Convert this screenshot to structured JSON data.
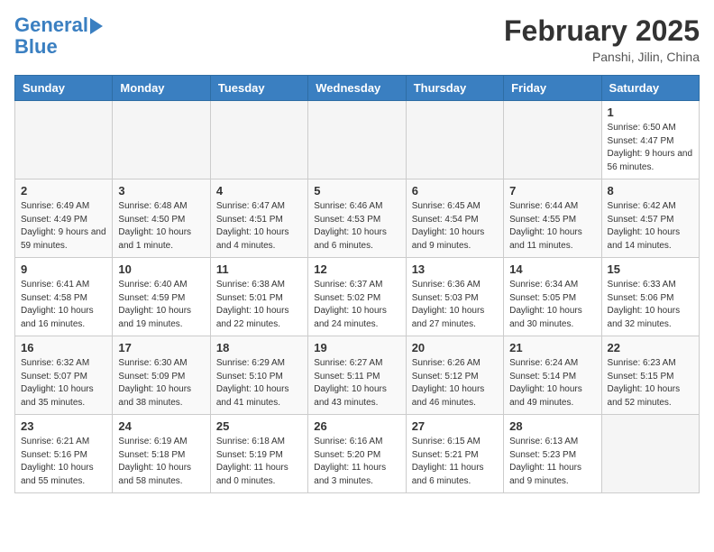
{
  "header": {
    "logo_line1": "General",
    "logo_line2": "Blue",
    "month_title": "February 2025",
    "location": "Panshi, Jilin, China"
  },
  "days_of_week": [
    "Sunday",
    "Monday",
    "Tuesday",
    "Wednesday",
    "Thursday",
    "Friday",
    "Saturday"
  ],
  "weeks": [
    [
      {
        "day": "",
        "info": ""
      },
      {
        "day": "",
        "info": ""
      },
      {
        "day": "",
        "info": ""
      },
      {
        "day": "",
        "info": ""
      },
      {
        "day": "",
        "info": ""
      },
      {
        "day": "",
        "info": ""
      },
      {
        "day": "1",
        "info": "Sunrise: 6:50 AM\nSunset: 4:47 PM\nDaylight: 9 hours and 56 minutes."
      }
    ],
    [
      {
        "day": "2",
        "info": "Sunrise: 6:49 AM\nSunset: 4:49 PM\nDaylight: 9 hours and 59 minutes."
      },
      {
        "day": "3",
        "info": "Sunrise: 6:48 AM\nSunset: 4:50 PM\nDaylight: 10 hours and 1 minute."
      },
      {
        "day": "4",
        "info": "Sunrise: 6:47 AM\nSunset: 4:51 PM\nDaylight: 10 hours and 4 minutes."
      },
      {
        "day": "5",
        "info": "Sunrise: 6:46 AM\nSunset: 4:53 PM\nDaylight: 10 hours and 6 minutes."
      },
      {
        "day": "6",
        "info": "Sunrise: 6:45 AM\nSunset: 4:54 PM\nDaylight: 10 hours and 9 minutes."
      },
      {
        "day": "7",
        "info": "Sunrise: 6:44 AM\nSunset: 4:55 PM\nDaylight: 10 hours and 11 minutes."
      },
      {
        "day": "8",
        "info": "Sunrise: 6:42 AM\nSunset: 4:57 PM\nDaylight: 10 hours and 14 minutes."
      }
    ],
    [
      {
        "day": "9",
        "info": "Sunrise: 6:41 AM\nSunset: 4:58 PM\nDaylight: 10 hours and 16 minutes."
      },
      {
        "day": "10",
        "info": "Sunrise: 6:40 AM\nSunset: 4:59 PM\nDaylight: 10 hours and 19 minutes."
      },
      {
        "day": "11",
        "info": "Sunrise: 6:38 AM\nSunset: 5:01 PM\nDaylight: 10 hours and 22 minutes."
      },
      {
        "day": "12",
        "info": "Sunrise: 6:37 AM\nSunset: 5:02 PM\nDaylight: 10 hours and 24 minutes."
      },
      {
        "day": "13",
        "info": "Sunrise: 6:36 AM\nSunset: 5:03 PM\nDaylight: 10 hours and 27 minutes."
      },
      {
        "day": "14",
        "info": "Sunrise: 6:34 AM\nSunset: 5:05 PM\nDaylight: 10 hours and 30 minutes."
      },
      {
        "day": "15",
        "info": "Sunrise: 6:33 AM\nSunset: 5:06 PM\nDaylight: 10 hours and 32 minutes."
      }
    ],
    [
      {
        "day": "16",
        "info": "Sunrise: 6:32 AM\nSunset: 5:07 PM\nDaylight: 10 hours and 35 minutes."
      },
      {
        "day": "17",
        "info": "Sunrise: 6:30 AM\nSunset: 5:09 PM\nDaylight: 10 hours and 38 minutes."
      },
      {
        "day": "18",
        "info": "Sunrise: 6:29 AM\nSunset: 5:10 PM\nDaylight: 10 hours and 41 minutes."
      },
      {
        "day": "19",
        "info": "Sunrise: 6:27 AM\nSunset: 5:11 PM\nDaylight: 10 hours and 43 minutes."
      },
      {
        "day": "20",
        "info": "Sunrise: 6:26 AM\nSunset: 5:12 PM\nDaylight: 10 hours and 46 minutes."
      },
      {
        "day": "21",
        "info": "Sunrise: 6:24 AM\nSunset: 5:14 PM\nDaylight: 10 hours and 49 minutes."
      },
      {
        "day": "22",
        "info": "Sunrise: 6:23 AM\nSunset: 5:15 PM\nDaylight: 10 hours and 52 minutes."
      }
    ],
    [
      {
        "day": "23",
        "info": "Sunrise: 6:21 AM\nSunset: 5:16 PM\nDaylight: 10 hours and 55 minutes."
      },
      {
        "day": "24",
        "info": "Sunrise: 6:19 AM\nSunset: 5:18 PM\nDaylight: 10 hours and 58 minutes."
      },
      {
        "day": "25",
        "info": "Sunrise: 6:18 AM\nSunset: 5:19 PM\nDaylight: 11 hours and 0 minutes."
      },
      {
        "day": "26",
        "info": "Sunrise: 6:16 AM\nSunset: 5:20 PM\nDaylight: 11 hours and 3 minutes."
      },
      {
        "day": "27",
        "info": "Sunrise: 6:15 AM\nSunset: 5:21 PM\nDaylight: 11 hours and 6 minutes."
      },
      {
        "day": "28",
        "info": "Sunrise: 6:13 AM\nSunset: 5:23 PM\nDaylight: 11 hours and 9 minutes."
      },
      {
        "day": "",
        "info": ""
      }
    ]
  ]
}
